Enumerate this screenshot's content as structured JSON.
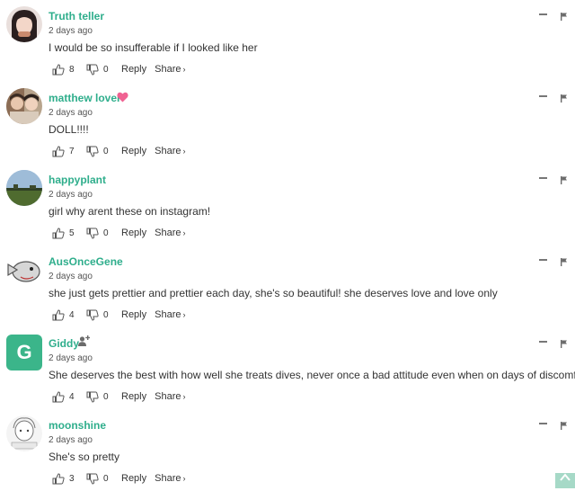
{
  "labels": {
    "reply": "Reply",
    "share": "Share",
    "share_chevron": "›"
  },
  "comments": [
    {
      "author": "Truth teller",
      "date": "2 days ago",
      "text": "I would be so insufferable if I looked like her",
      "likes": "8",
      "dislikes": "0",
      "badge": ""
    },
    {
      "author": "matthew lover",
      "date": "2 days ago",
      "text": "DOLL!!!!",
      "likes": "7",
      "dislikes": "0",
      "badge": "heart-icon"
    },
    {
      "author": "happyplant",
      "date": "2 days ago",
      "text": "girl why arent these on instagram!",
      "likes": "5",
      "dislikes": "0",
      "badge": ""
    },
    {
      "author": "AusOnceGene",
      "date": "2 days ago",
      "text": "she just gets prettier and prettier each day, she's so beautiful! she deserves love and love only",
      "likes": "4",
      "dislikes": "0",
      "badge": ""
    },
    {
      "author": "Giddy",
      "avatar_letter": "G",
      "date": "2 days ago",
      "text": "She deserves the best with how well she treats dives, never once a bad attitude even when on days of discomfort",
      "likes": "4",
      "dislikes": "0",
      "badge": "follow-icon"
    },
    {
      "author": "moonshine",
      "date": "2 days ago",
      "text": "She's so pretty",
      "likes": "3",
      "dislikes": "0",
      "badge": ""
    }
  ],
  "colors": {
    "author": "#2fae8c",
    "avatar_letter_bg": "#3bb58a",
    "heart": "#f06292",
    "scroll_top_bg": "#a6d9c7"
  },
  "icons": [
    "thumbs-up-icon",
    "thumbs-down-icon",
    "collapse-icon",
    "flag-icon",
    "chevron-up-icon"
  ]
}
